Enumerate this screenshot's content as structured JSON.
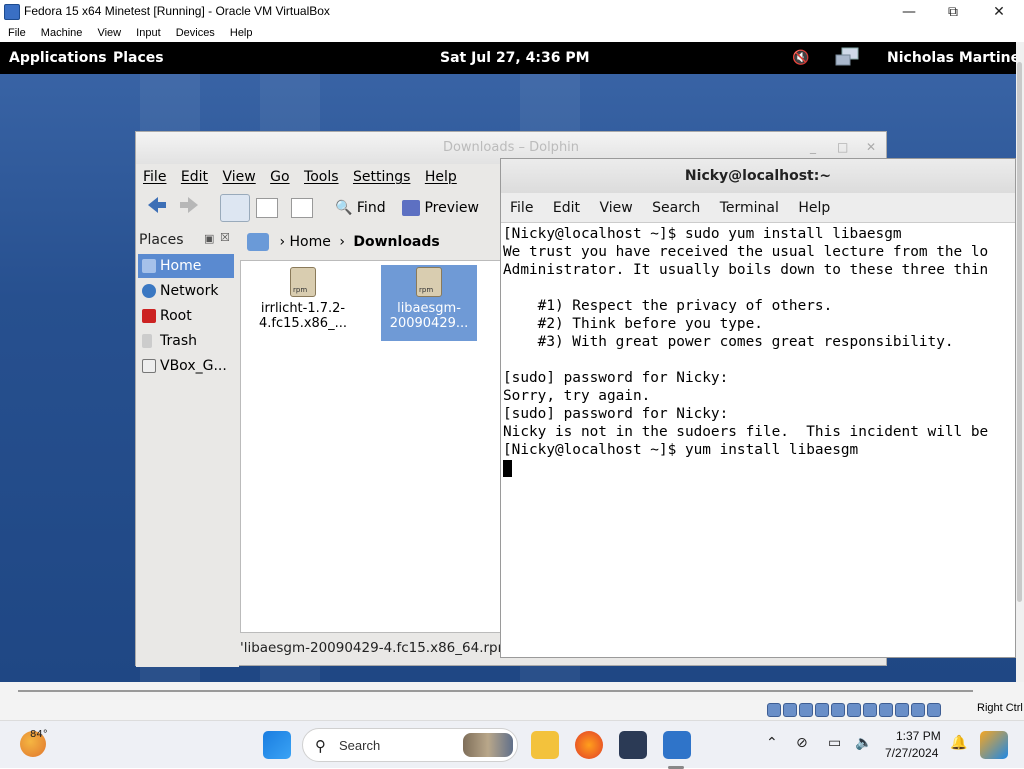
{
  "vbox": {
    "title": "Fedora 15 x64 Minetest [Running] - Oracle VM VirtualBox",
    "menu": [
      "File",
      "Machine",
      "View",
      "Input",
      "Devices",
      "Help"
    ],
    "host_key_label": "Right Ctrl"
  },
  "gnome_panel": {
    "applications": "Applications",
    "places": "Places",
    "clock": "Sat Jul 27,  4:36 PM",
    "user": "Nicholas Martine"
  },
  "dolphin": {
    "title": "Downloads – Dolphin",
    "menu": [
      "File",
      "Edit",
      "View",
      "Go",
      "Tools",
      "Settings",
      "Help"
    ],
    "toolbar": {
      "find": "Find",
      "preview": "Preview"
    },
    "places_header": "Places",
    "places": [
      "Home",
      "Network",
      "Root",
      "Trash",
      "VBox_G..."
    ],
    "breadcrumb": {
      "home": "Home",
      "current": "Downloads"
    },
    "files": [
      {
        "line1": "irrlicht-1.7.2-",
        "line2": "4.fc15.x86_..."
      },
      {
        "line1": "libaesgm-",
        "line2": "20090429..."
      }
    ],
    "status": "'libaesgm-20090429-4.fc15.x86_64.rpm"
  },
  "terminal": {
    "title": "Nicky@localhost:~",
    "menu": [
      "File",
      "Edit",
      "View",
      "Search",
      "Terminal",
      "Help"
    ],
    "lines": [
      "[Nicky@localhost ~]$ sudo yum install libaesgm",
      "",
      "We trust you have received the usual lecture from the lo",
      "Administrator. It usually boils down to these three thin",
      "",
      "    #1) Respect the privacy of others.",
      "    #2) Think before you type.",
      "    #3) With great power comes great responsibility.",
      "",
      "[sudo] password for Nicky:",
      "Sorry, try again.",
      "[sudo] password for Nicky:",
      "Nicky is not in the sudoers file.  This incident will be",
      "[Nicky@localhost ~]$ yum install libaesgm"
    ]
  },
  "taskbar": {
    "weather_temp": "84°",
    "search_placeholder": "Search",
    "time": "1:37 PM",
    "date": "7/27/2024"
  }
}
